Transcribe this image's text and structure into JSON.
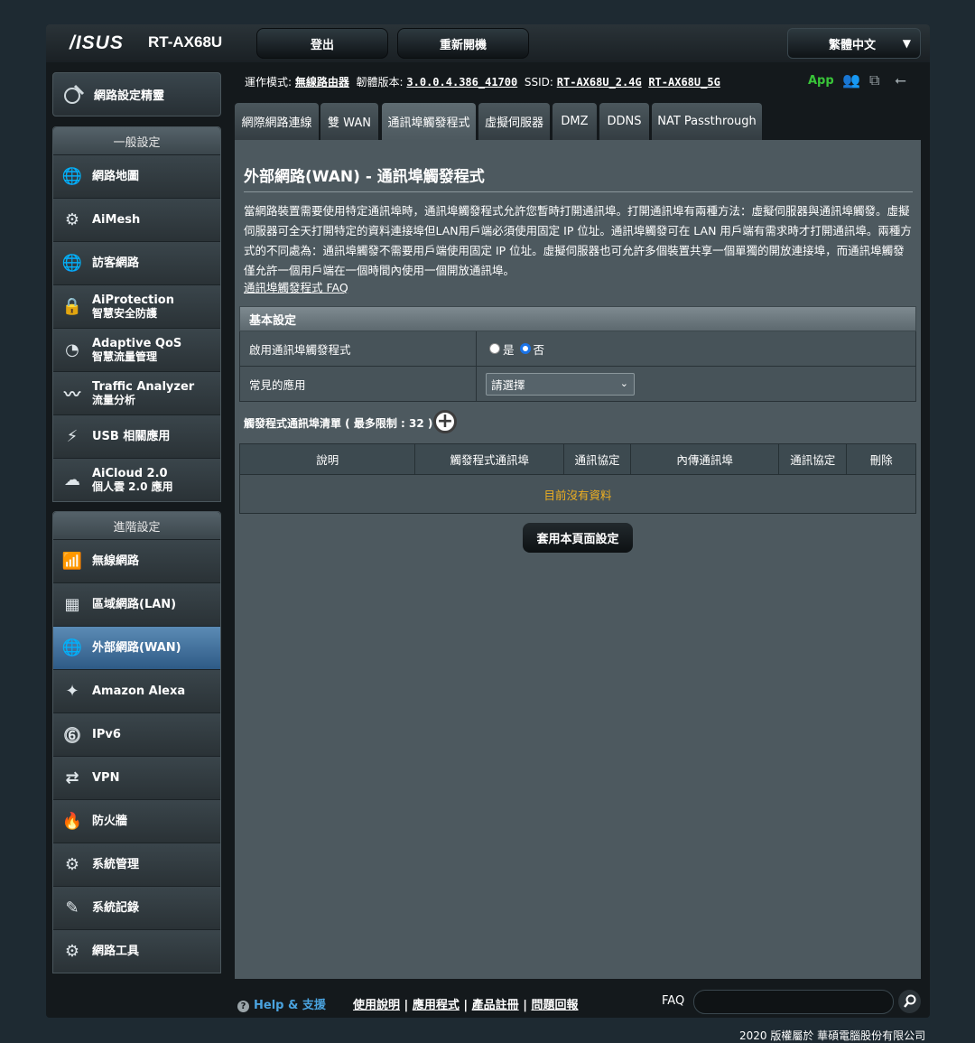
{
  "header": {
    "logo": "/ISUS",
    "model": "RT-AX68U",
    "logout": "登出",
    "reboot": "重新開機",
    "language": "繁體中文"
  },
  "nav": {
    "qis": "網路設定精靈",
    "general_title": "一般設定",
    "general": [
      {
        "icon": "globe-map-icon",
        "label": "網路地圖",
        "sub": ""
      },
      {
        "icon": "aimesh-icon",
        "label": "AiMesh",
        "sub": ""
      },
      {
        "icon": "guest-network-icon",
        "label": "訪客網路",
        "sub": ""
      },
      {
        "icon": "lock-shield-icon",
        "label": "AiProtection",
        "sub": "智慧安全防護"
      },
      {
        "icon": "speedometer-icon",
        "label": "Adaptive QoS",
        "sub": "智慧流量管理"
      },
      {
        "icon": "traffic-analyzer-icon",
        "label": "Traffic Analyzer",
        "sub": "流量分析"
      },
      {
        "icon": "usb-icon",
        "label": "USB 相關應用",
        "sub": ""
      },
      {
        "icon": "cloud-icon",
        "label": "AiCloud 2.0",
        "sub": "個人雲 2.0 應用"
      }
    ],
    "advanced_title": "進階設定",
    "advanced": [
      {
        "icon": "wireless-icon",
        "label": "無線網路",
        "sub": ""
      },
      {
        "icon": "lan-icon",
        "label": "區域網路(LAN)",
        "sub": ""
      },
      {
        "icon": "wan-globe-icon",
        "label": "外部網路(WAN)",
        "sub": ""
      },
      {
        "icon": "alexa-icon",
        "label": "Amazon Alexa",
        "sub": ""
      },
      {
        "icon": "ipv6-icon",
        "label": "IPv6",
        "sub": ""
      },
      {
        "icon": "vpn-icon",
        "label": "VPN",
        "sub": ""
      },
      {
        "icon": "firewall-icon",
        "label": "防火牆",
        "sub": ""
      },
      {
        "icon": "admin-gear-icon",
        "label": "系統管理",
        "sub": ""
      },
      {
        "icon": "log-icon",
        "label": "系統記錄",
        "sub": ""
      },
      {
        "icon": "tools-icon",
        "label": "網路工具",
        "sub": ""
      }
    ]
  },
  "status": {
    "mode_label": "運作模式:",
    "mode_value": "無線路由器",
    "fw_label": "韌體版本:",
    "fw_value": "3.0.0.4.386_41700",
    "ssid_label": "SSID:",
    "ssid_24": "RT-AX68U_2.4G",
    "ssid_5": "RT-AX68U_5G",
    "app": "App"
  },
  "tabs": [
    "網際網路連線",
    "雙 WAN",
    "通訊埠觸發程式",
    "虛擬伺服器",
    "DMZ",
    "DDNS",
    "NAT Passthrough"
  ],
  "page": {
    "title": "外部網路(WAN) - 通訊埠觸發程式",
    "description": "當網路裝置需要使用特定通訊埠時，通訊埠觸發程式允許您暫時打開通訊埠。打開通訊埠有兩種方法：虛擬伺服器與通訊埠觸發。虛擬伺服器可全天打開特定的資料連接埠但LAN用戶端必須使用固定 IP 位址。通訊埠觸發可在 LAN 用戶端有需求時才打開通訊埠。兩種方式的不同處為：通訊埠觸發不需要用戶端使用固定 IP 位址。虛擬伺服器也可允許多個裝置共享一個單獨的開放連接埠，而通訊埠觸發僅允許一個用戶端在一個時間內使用一個開放通訊埠。",
    "faq_link": "通訊埠觸發程式 FAQ",
    "basic_section": "基本設定",
    "enable_label": "啟用通訊埠觸發程式",
    "yes": "是",
    "no": "否",
    "common_label": "常見的應用",
    "common_select": "請選擇",
    "list_title": "觸發程式通訊埠清單 ( 最多限制 : 32 )",
    "columns": [
      "說明",
      "觸發程式通訊埠",
      "通訊協定",
      "內傳通訊埠",
      "通訊協定",
      "刪除"
    ],
    "empty": "目前沒有資料",
    "apply": "套用本頁面設定"
  },
  "footer": {
    "help": "Help & 支援",
    "links": [
      "使用說明",
      "應用程式",
      "產品註冊",
      "問題回報"
    ],
    "faq_label": "FAQ",
    "faq_placeholder": "",
    "copyright": "2020 版權屬於 華碩電腦股份有限公司"
  }
}
